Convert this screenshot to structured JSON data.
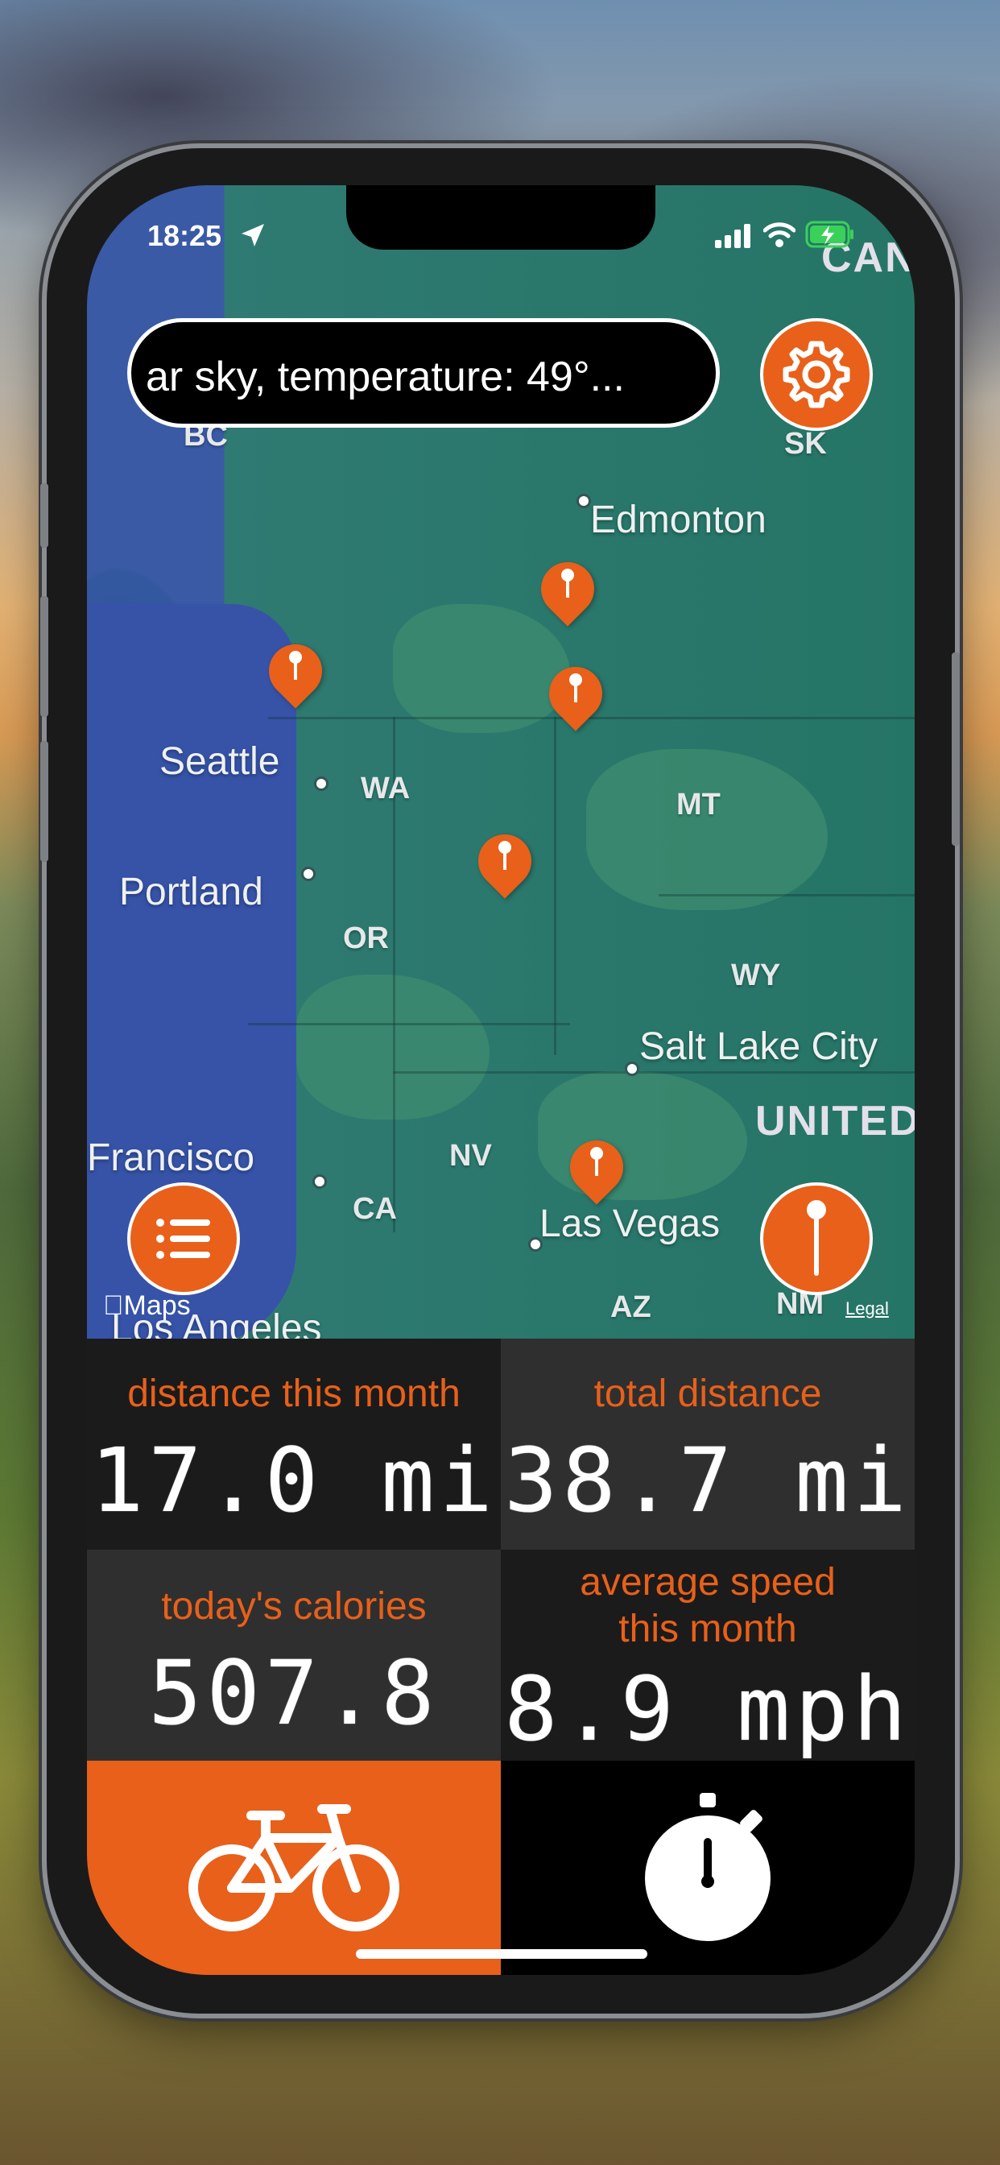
{
  "status_bar": {
    "time": "18:25"
  },
  "search": {
    "text": "ar sky, temperature: 49°..."
  },
  "map": {
    "cities": [
      "Edmonton",
      "Seattle",
      "Portland",
      "Salt Lake City",
      "Las Vegas",
      "Francisco",
      "Los Angeles"
    ],
    "states": [
      "BC",
      "SK",
      "WA",
      "MT",
      "OR",
      "WY",
      "NV",
      "CA",
      "AZ",
      "NM"
    ],
    "countries": [
      "CAN",
      "UNITED"
    ],
    "attribution": "Maps",
    "legal": "Legal"
  },
  "stats": {
    "month_distance_label": "distance this month",
    "month_distance_value": "17.0 mi",
    "total_distance_label": "total distance",
    "total_distance_value": "38.7 mi",
    "calories_label": "today's calories",
    "calories_value": "507.8",
    "avg_speed_label_1": "average speed",
    "avg_speed_label_2": "this month",
    "avg_speed_value": "8.9 mph"
  },
  "colors": {
    "accent": "#e8601a",
    "dark_cell": "#1b1b1b",
    "light_cell": "#2f2f2f"
  },
  "icons": [
    "location-arrow-icon",
    "signal-icon",
    "wifi-icon",
    "battery-icon",
    "gear-icon",
    "list-icon",
    "pin-icon",
    "bicycle-icon",
    "stopwatch-icon"
  ]
}
